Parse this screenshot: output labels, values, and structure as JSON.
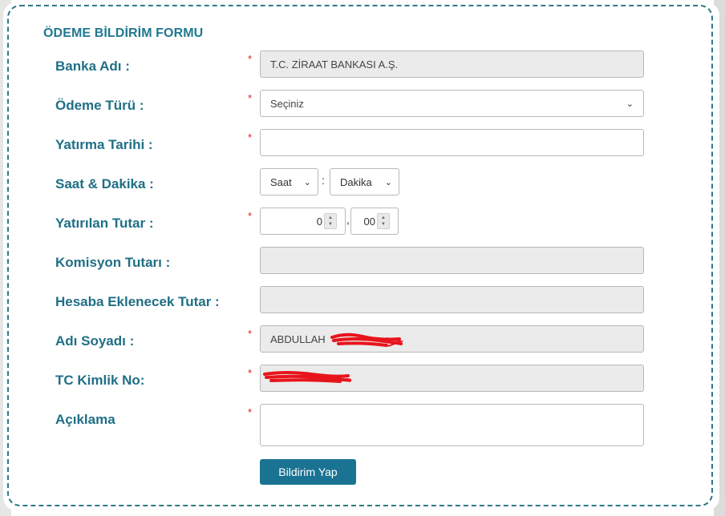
{
  "form": {
    "title": "ÖDEME BİLDİRİM FORMU",
    "required_mark": "*",
    "bank": {
      "label": "Banka Adı :",
      "value": "T.C. ZİRAAT BANKASI A.Ş."
    },
    "payment_type": {
      "label": "Ödeme Türü :",
      "value": "Seçiniz"
    },
    "deposit_date": {
      "label": "Yatırma Tarihi :",
      "value": ""
    },
    "time": {
      "label": "Saat & Dakika :",
      "hour_value": "Saat",
      "minute_value": "Dakika",
      "separator": ":"
    },
    "amount": {
      "label": "Yatırılan Tutar :",
      "whole_value": "0",
      "decimal_value": "00",
      "separator": ","
    },
    "commission": {
      "label": "Komisyon Tutarı :",
      "value": ""
    },
    "account_amount": {
      "label": "Hesaba Eklenecek Tutar :",
      "value": ""
    },
    "name": {
      "label": "Adı Soyadı :",
      "value": "ABDULLAH"
    },
    "tc_id": {
      "label": "TC Kimlik No:",
      "value": ""
    },
    "description": {
      "label": "Açıklama",
      "value": ""
    },
    "submit_label": "Bildirim Yap"
  },
  "colors": {
    "accent": "#1f7890",
    "button": "#1a7392",
    "required": "#e0201a",
    "readonly_bg": "#ebebeb",
    "redaction": "#e8141c"
  },
  "icons": {
    "select_arrow": "chevron-down-icon",
    "spinner": "spinner-arrows-icon"
  }
}
